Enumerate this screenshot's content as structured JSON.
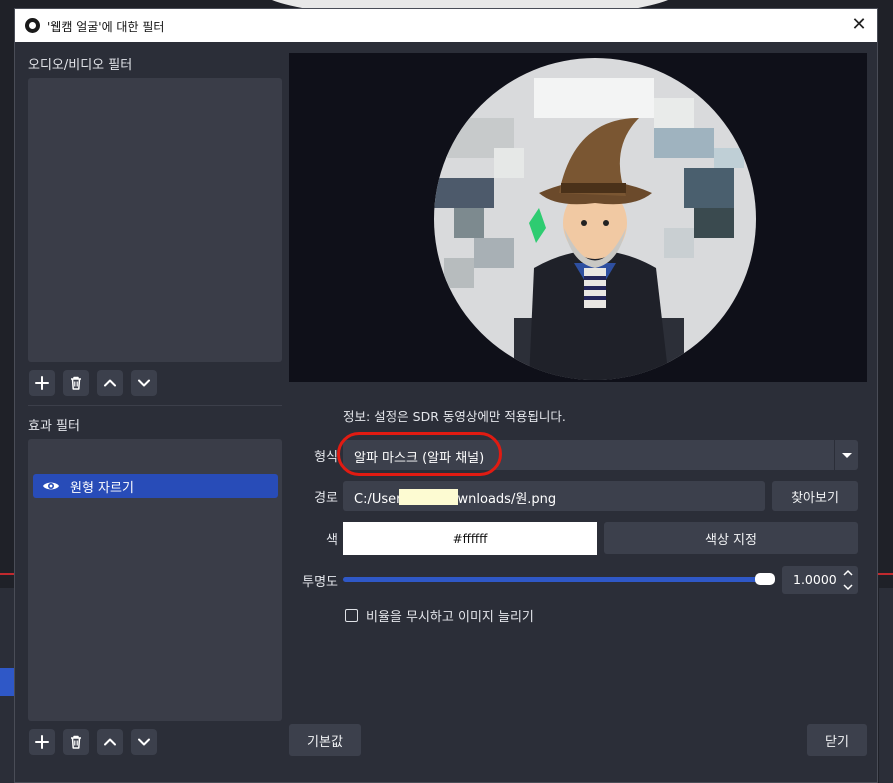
{
  "dialog": {
    "title": "'웹캠 얼굴'에 대한 필터",
    "close_glyph": "✕"
  },
  "left_panel": {
    "av_filters_label": "오디오/비디오 필터",
    "effect_filters_label": "효과 필터",
    "effect_filters": [
      {
        "label": "원형 자르기",
        "selected": true,
        "visible_icon": "eye-icon"
      }
    ],
    "toolbar_icons": [
      "plus-icon",
      "trash-icon",
      "chevron-up-icon",
      "chevron-down-icon"
    ]
  },
  "settings": {
    "info": "정보: 설정은 SDR 동영상에만 적용됩니다.",
    "type_label": "형식",
    "type_value": "알파 마스크 (알파 채널)",
    "path_label": "경로",
    "path_value": "C:/Users          ownloads/원.png",
    "browse_label": "찾아보기",
    "color_label": "색",
    "color_value": "#ffffff",
    "pick_color_label": "색상 지정",
    "opacity_label": "투명도",
    "opacity_value": "1.0000",
    "stretch_label": "비율을 무시하고 이미지 늘리기",
    "stretch_checked": false
  },
  "footer": {
    "defaults_label": "기본값",
    "close_label": "닫기"
  },
  "colors": {
    "accent": "#284cb8",
    "highlight_circle": "#e11b12",
    "panel_bg": "#2b2e38",
    "control_bg": "#3c404c"
  }
}
